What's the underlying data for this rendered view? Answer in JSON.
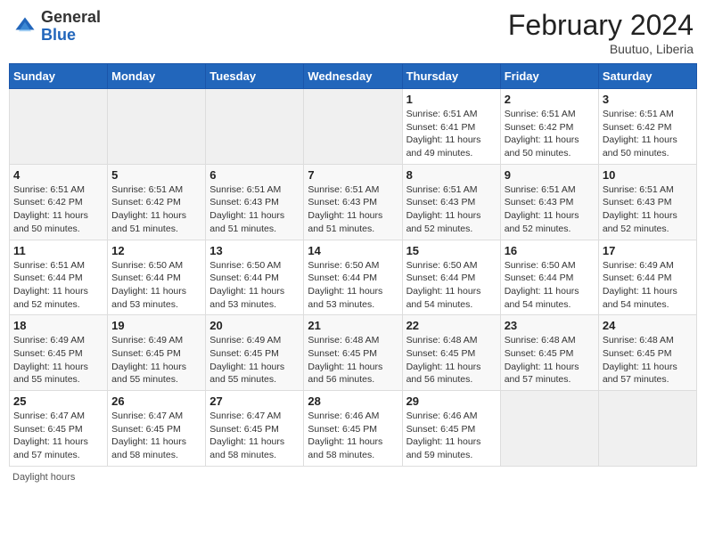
{
  "header": {
    "logo_general": "General",
    "logo_blue": "Blue",
    "title": "February 2024",
    "location": "Buutuo, Liberia"
  },
  "footer": {
    "daylight_label": "Daylight hours"
  },
  "weekdays": [
    "Sunday",
    "Monday",
    "Tuesday",
    "Wednesday",
    "Thursday",
    "Friday",
    "Saturday"
  ],
  "weeks": [
    [
      {
        "day": "",
        "info": ""
      },
      {
        "day": "",
        "info": ""
      },
      {
        "day": "",
        "info": ""
      },
      {
        "day": "",
        "info": ""
      },
      {
        "day": "1",
        "info": "Sunrise: 6:51 AM\nSunset: 6:41 PM\nDaylight: 11 hours\nand 49 minutes."
      },
      {
        "day": "2",
        "info": "Sunrise: 6:51 AM\nSunset: 6:42 PM\nDaylight: 11 hours\nand 50 minutes."
      },
      {
        "day": "3",
        "info": "Sunrise: 6:51 AM\nSunset: 6:42 PM\nDaylight: 11 hours\nand 50 minutes."
      }
    ],
    [
      {
        "day": "4",
        "info": "Sunrise: 6:51 AM\nSunset: 6:42 PM\nDaylight: 11 hours\nand 50 minutes."
      },
      {
        "day": "5",
        "info": "Sunrise: 6:51 AM\nSunset: 6:42 PM\nDaylight: 11 hours\nand 51 minutes."
      },
      {
        "day": "6",
        "info": "Sunrise: 6:51 AM\nSunset: 6:43 PM\nDaylight: 11 hours\nand 51 minutes."
      },
      {
        "day": "7",
        "info": "Sunrise: 6:51 AM\nSunset: 6:43 PM\nDaylight: 11 hours\nand 51 minutes."
      },
      {
        "day": "8",
        "info": "Sunrise: 6:51 AM\nSunset: 6:43 PM\nDaylight: 11 hours\nand 52 minutes."
      },
      {
        "day": "9",
        "info": "Sunrise: 6:51 AM\nSunset: 6:43 PM\nDaylight: 11 hours\nand 52 minutes."
      },
      {
        "day": "10",
        "info": "Sunrise: 6:51 AM\nSunset: 6:43 PM\nDaylight: 11 hours\nand 52 minutes."
      }
    ],
    [
      {
        "day": "11",
        "info": "Sunrise: 6:51 AM\nSunset: 6:44 PM\nDaylight: 11 hours\nand 52 minutes."
      },
      {
        "day": "12",
        "info": "Sunrise: 6:50 AM\nSunset: 6:44 PM\nDaylight: 11 hours\nand 53 minutes."
      },
      {
        "day": "13",
        "info": "Sunrise: 6:50 AM\nSunset: 6:44 PM\nDaylight: 11 hours\nand 53 minutes."
      },
      {
        "day": "14",
        "info": "Sunrise: 6:50 AM\nSunset: 6:44 PM\nDaylight: 11 hours\nand 53 minutes."
      },
      {
        "day": "15",
        "info": "Sunrise: 6:50 AM\nSunset: 6:44 PM\nDaylight: 11 hours\nand 54 minutes."
      },
      {
        "day": "16",
        "info": "Sunrise: 6:50 AM\nSunset: 6:44 PM\nDaylight: 11 hours\nand 54 minutes."
      },
      {
        "day": "17",
        "info": "Sunrise: 6:49 AM\nSunset: 6:44 PM\nDaylight: 11 hours\nand 54 minutes."
      }
    ],
    [
      {
        "day": "18",
        "info": "Sunrise: 6:49 AM\nSunset: 6:45 PM\nDaylight: 11 hours\nand 55 minutes."
      },
      {
        "day": "19",
        "info": "Sunrise: 6:49 AM\nSunset: 6:45 PM\nDaylight: 11 hours\nand 55 minutes."
      },
      {
        "day": "20",
        "info": "Sunrise: 6:49 AM\nSunset: 6:45 PM\nDaylight: 11 hours\nand 55 minutes."
      },
      {
        "day": "21",
        "info": "Sunrise: 6:48 AM\nSunset: 6:45 PM\nDaylight: 11 hours\nand 56 minutes."
      },
      {
        "day": "22",
        "info": "Sunrise: 6:48 AM\nSunset: 6:45 PM\nDaylight: 11 hours\nand 56 minutes."
      },
      {
        "day": "23",
        "info": "Sunrise: 6:48 AM\nSunset: 6:45 PM\nDaylight: 11 hours\nand 57 minutes."
      },
      {
        "day": "24",
        "info": "Sunrise: 6:48 AM\nSunset: 6:45 PM\nDaylight: 11 hours\nand 57 minutes."
      }
    ],
    [
      {
        "day": "25",
        "info": "Sunrise: 6:47 AM\nSunset: 6:45 PM\nDaylight: 11 hours\nand 57 minutes."
      },
      {
        "day": "26",
        "info": "Sunrise: 6:47 AM\nSunset: 6:45 PM\nDaylight: 11 hours\nand 58 minutes."
      },
      {
        "day": "27",
        "info": "Sunrise: 6:47 AM\nSunset: 6:45 PM\nDaylight: 11 hours\nand 58 minutes."
      },
      {
        "day": "28",
        "info": "Sunrise: 6:46 AM\nSunset: 6:45 PM\nDaylight: 11 hours\nand 58 minutes."
      },
      {
        "day": "29",
        "info": "Sunrise: 6:46 AM\nSunset: 6:45 PM\nDaylight: 11 hours\nand 59 minutes."
      },
      {
        "day": "",
        "info": ""
      },
      {
        "day": "",
        "info": ""
      }
    ]
  ]
}
